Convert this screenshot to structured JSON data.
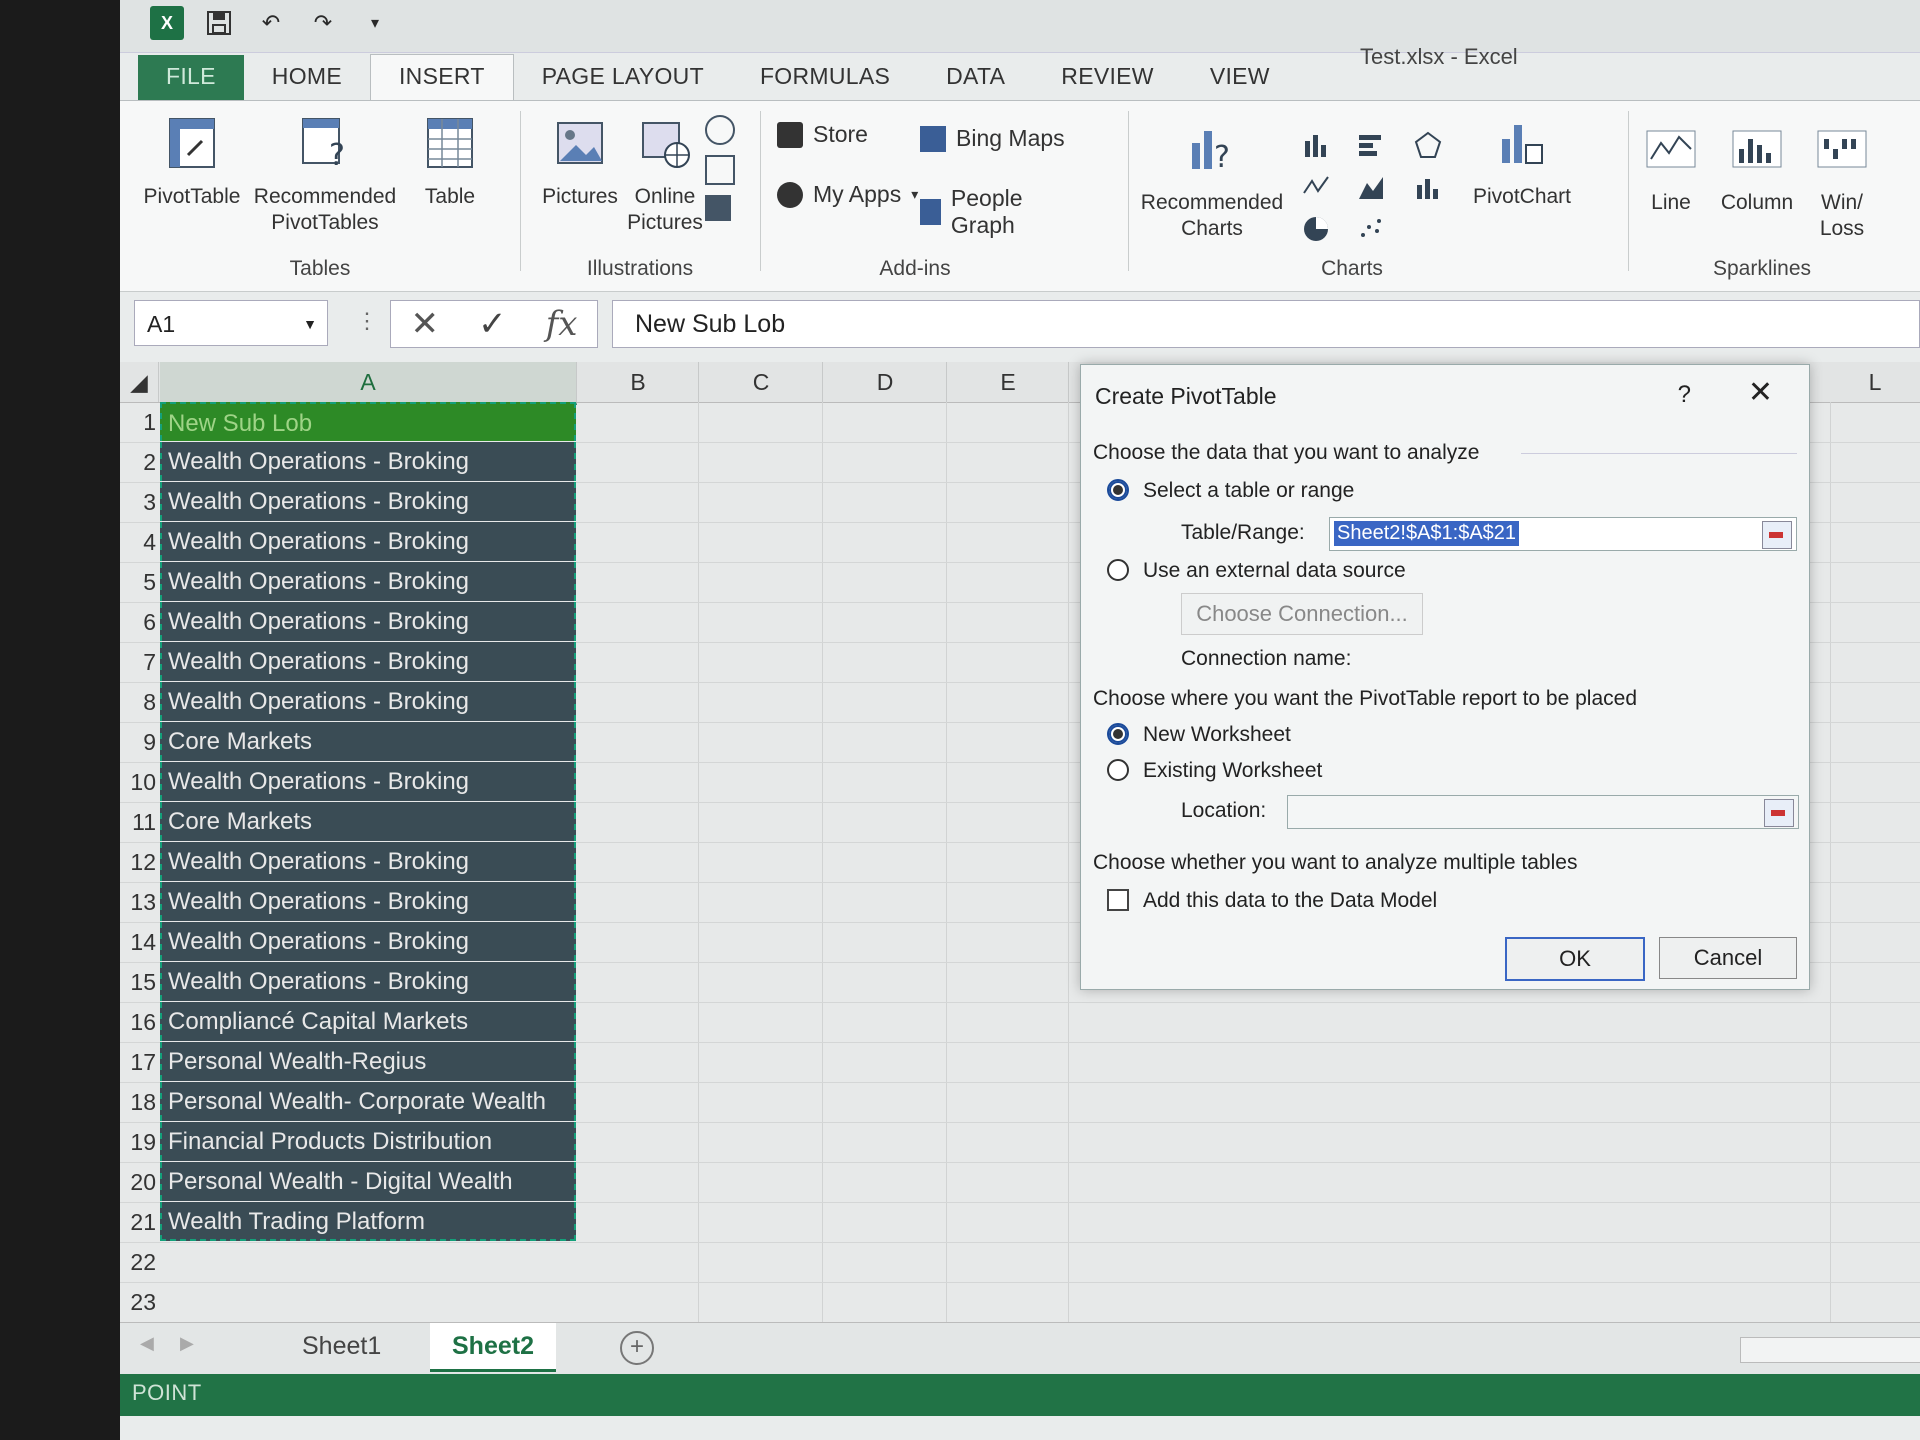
{
  "window": {
    "title": "Test.xlsx - Excel"
  },
  "tabs": [
    "FILE",
    "HOME",
    "INSERT",
    "PAGE LAYOUT",
    "FORMULAS",
    "DATA",
    "REVIEW",
    "VIEW"
  ],
  "ribbon": {
    "pivot_table": "PivotTable",
    "recommended_pivot_1": "Recommended",
    "recommended_pivot_2": "PivotTables",
    "table": "Table",
    "tables_group": "Tables",
    "pictures": "Pictures",
    "online_1": "Online",
    "online_2": "Pictures",
    "illustrations_group": "Illustrations",
    "store": "Store",
    "my_apps": "My Apps",
    "bing_maps": "Bing Maps",
    "people_graph": "People Graph",
    "addins_group": "Add-ins",
    "rec_charts_1": "Recommended",
    "rec_charts_2": "Charts",
    "charts_group": "Charts",
    "pivot_chart": "PivotChart",
    "line": "Line",
    "column": "Column",
    "winloss_1": "Win/",
    "winloss_2": "Loss",
    "sparklines_group": "Sparklines"
  },
  "formula_bar": {
    "name_box": "A1",
    "value": "New Sub Lob"
  },
  "columns": [
    "A",
    "B",
    "C",
    "D",
    "E",
    "L"
  ],
  "rows": [
    {
      "n": "1",
      "a": "New Sub Lob"
    },
    {
      "n": "2",
      "a": "Wealth Operations - Broking"
    },
    {
      "n": "3",
      "a": "Wealth Operations - Broking"
    },
    {
      "n": "4",
      "a": "Wealth Operations - Broking"
    },
    {
      "n": "5",
      "a": "Wealth Operations - Broking"
    },
    {
      "n": "6",
      "a": "Wealth Operations - Broking"
    },
    {
      "n": "7",
      "a": "Wealth Operations - Broking"
    },
    {
      "n": "8",
      "a": "Wealth Operations - Broking"
    },
    {
      "n": "9",
      "a": "Core Markets"
    },
    {
      "n": "10",
      "a": "Wealth Operations - Broking"
    },
    {
      "n": "11",
      "a": "Core Markets"
    },
    {
      "n": "12",
      "a": "Wealth Operations - Broking"
    },
    {
      "n": "13",
      "a": "Wealth Operations - Broking"
    },
    {
      "n": "14",
      "a": "Wealth Operations - Broking"
    },
    {
      "n": "15",
      "a": "Wealth Operations - Broking"
    },
    {
      "n": "16",
      "a": "Compliancé Capital Markets"
    },
    {
      "n": "17",
      "a": "Personal Wealth-Regius"
    },
    {
      "n": "18",
      "a": "Personal Wealth- Corporate Wealth"
    },
    {
      "n": "19",
      "a": "Financial Products Distribution"
    },
    {
      "n": "20",
      "a": "Personal Wealth - Digital Wealth"
    },
    {
      "n": "21",
      "a": "Wealth Trading Platform"
    },
    {
      "n": "22",
      "a": ""
    },
    {
      "n": "23",
      "a": ""
    }
  ],
  "sheets": [
    "Sheet1",
    "Sheet2"
  ],
  "status": "POINT",
  "dialog": {
    "title": "Create PivotTable",
    "help": "?",
    "section1": "Choose the data that you want to analyze",
    "opt_select": "Select a table or range",
    "table_range_label": "Table/Range:",
    "table_range_value": "Sheet2!$A$1:$A$21",
    "opt_external": "Use an external data source",
    "choose_connection": "Choose Connection...",
    "connection_name": "Connection name:",
    "section2": "Choose where you want the PivotTable report to be placed",
    "opt_new": "New Worksheet",
    "opt_existing": "Existing Worksheet",
    "location_label": "Location:",
    "section3": "Choose whether you want to analyze multiple tables",
    "add_data_model": "Add this data to the Data Model",
    "ok": "OK",
    "cancel": "Cancel"
  }
}
